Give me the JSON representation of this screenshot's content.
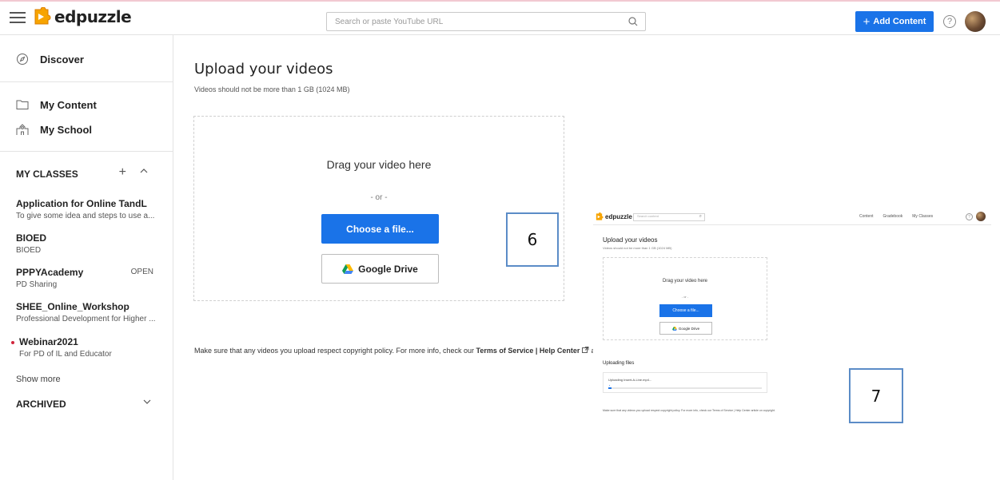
{
  "header": {
    "logo_text": "edpuzzle",
    "search_placeholder": "Search or paste YouTube URL",
    "add_content_label": "Add Content",
    "help_glyph": "?"
  },
  "sidebar": {
    "nav": [
      {
        "label": "Discover",
        "icon": "compass-icon"
      },
      {
        "label": "My Content",
        "icon": "folder-icon"
      },
      {
        "label": "My School",
        "icon": "school-icon"
      }
    ],
    "classes_heading": "MY CLASSES",
    "classes": [
      {
        "title": "Application for Online TandL",
        "subtitle": "To give some idea and steps to use a..."
      },
      {
        "title": "BIOED",
        "subtitle": "BIOED"
      },
      {
        "title": "PPPYAcademy",
        "subtitle": "PD Sharing",
        "badge": "OPEN"
      },
      {
        "title": "SHEE_Online_Workshop",
        "subtitle": "Professional Development for Higher ..."
      },
      {
        "title": "Webinar2021",
        "subtitle": "For PD of IL and Educator",
        "dot": true
      }
    ],
    "show_more": "Show more",
    "archived_heading": "ARCHIVED"
  },
  "main": {
    "title": "Upload your videos",
    "subtitle": "Videos should not be more than 1 GB (1024 MB)",
    "drag_text": "Drag your video here",
    "or_text": "- or -",
    "choose_label": "Choose a file...",
    "gdrive_label": "Google Drive",
    "copyright_prefix": "Make sure that any videos you upload respect copyright policy. For more info, check our ",
    "copyright_links": "Terms of Service | Help Center",
    "copyright_suffix": " arti"
  },
  "steps": {
    "a": "6",
    "b": "7"
  },
  "inset": {
    "logo_text": "edpuzzle",
    "search_placeholder": "Search content",
    "nav": [
      "Content",
      "Gradebook",
      "My Classes"
    ],
    "title": "Upload your videos",
    "subtitle": "Videos should not be more than 1 GB (1024 MB)",
    "drag_text": "Drag your video here",
    "or_text": "- or -",
    "choose_label": "Choose a file...",
    "gdrive_label": "Google Drive",
    "uploading_title": "Uploading files",
    "uploading_file": "Uploading Insert-A-Line.mp4...",
    "upload_progress": 0.02,
    "copyright": "Make sure that any videos you upload respect copyright policy. For more info, check our Terms of Service | Help Center article on copyright."
  },
  "colors": {
    "accent": "#1a73e8",
    "step_border": "#5b8cc7",
    "class_dot": "#d0253c"
  }
}
